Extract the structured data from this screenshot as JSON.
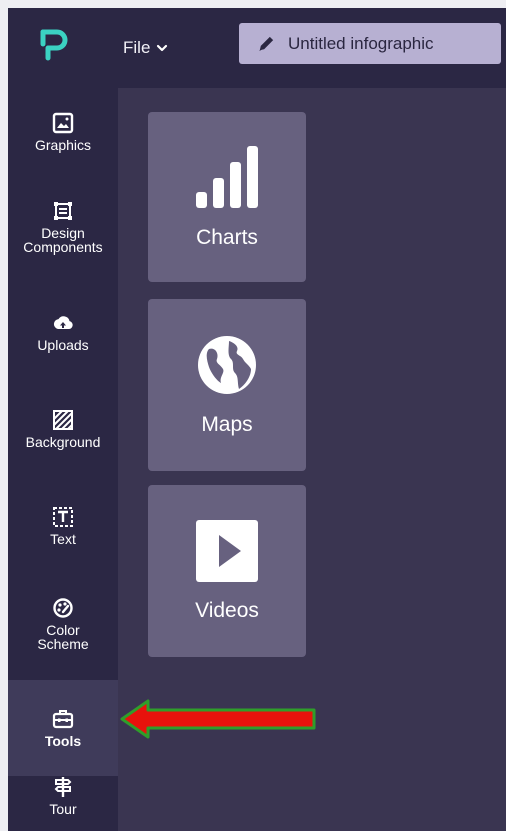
{
  "header": {
    "file_label": "File",
    "document_title": "Untitled infographic"
  },
  "sidebar": {
    "items": [
      {
        "label": "Graphics",
        "icon": "image-icon"
      },
      {
        "label": "Design\nComponents",
        "icon": "components-icon"
      },
      {
        "label": "Uploads",
        "icon": "cloud-upload-icon"
      },
      {
        "label": "Background",
        "icon": "background-pattern-icon"
      },
      {
        "label": "Text",
        "icon": "text-icon"
      },
      {
        "label": "Color\nScheme",
        "icon": "palette-icon"
      },
      {
        "label": "Tools",
        "icon": "toolbox-icon",
        "active": true
      },
      {
        "label": "Tour",
        "icon": "signpost-icon"
      }
    ]
  },
  "tools_panel": {
    "cards": [
      {
        "label": "Charts",
        "icon": "bar-chart-icon"
      },
      {
        "label": "Maps",
        "icon": "globe-icon"
      },
      {
        "label": "Videos",
        "icon": "play-icon"
      }
    ]
  },
  "annotation": {
    "arrow_color": "#e8120c",
    "arrow_outline": "#2f9e2a"
  },
  "colors": {
    "background": "#2b2744",
    "panel": "#3a3551",
    "card": "#67617f",
    "title_box": "#b7b0d2",
    "logo": "#3bd2c2"
  }
}
